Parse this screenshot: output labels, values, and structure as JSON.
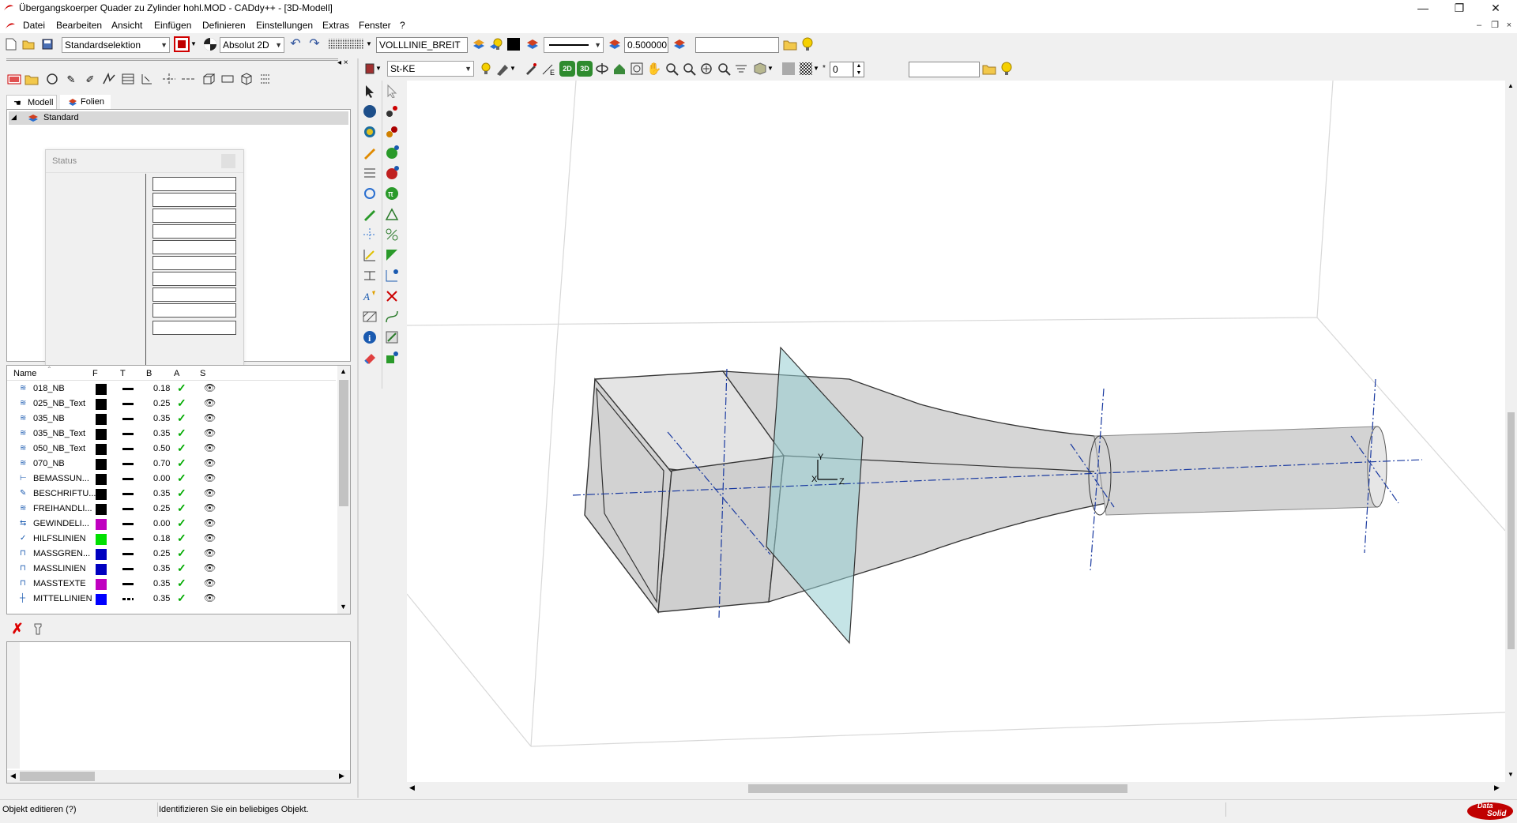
{
  "window": {
    "title": "Übergangskoerper Quader zu Zylinder hohl.MOD  -  CADdy++ - [3D-Modell]",
    "minimize_glyph": "—",
    "restore_glyph": "❐",
    "close_glyph": "✕"
  },
  "menu": [
    "Datei",
    "Bearbeiten",
    "Ansicht",
    "Einfügen",
    "Definieren",
    "Einstellungen",
    "Extras",
    "Fenster",
    "?"
  ],
  "toolbar1": {
    "selection_mode": "Standardselektion",
    "coordinate_mode": "Absolut 2D",
    "line_type_name": "VOLLLINIE_BREIT",
    "line_width": "0.500000",
    "search_value": ""
  },
  "toolbar2": {
    "material": "St-KE",
    "label_2d": "2D",
    "label_3d": "3D",
    "counter_value": "0",
    "search_value": ""
  },
  "panel": {
    "tab_model": "Modell",
    "tab_layers": "Folien",
    "tree_root": "Standard",
    "status_popup_title": "Status",
    "columns": [
      "Name",
      "F",
      "T",
      "B",
      "A",
      "S"
    ],
    "layers": [
      {
        "name": "018_NB",
        "color": "#000000",
        "width": "0.18",
        "icon": "layer-icon"
      },
      {
        "name": "025_NB_Text",
        "color": "#000000",
        "width": "0.25",
        "icon": "layer-icon"
      },
      {
        "name": "035_NB",
        "color": "#000000",
        "width": "0.35",
        "icon": "layer-icon"
      },
      {
        "name": "035_NB_Text",
        "color": "#000000",
        "width": "0.35",
        "icon": "layer-icon"
      },
      {
        "name": "050_NB_Text",
        "color": "#000000",
        "width": "0.50",
        "icon": "layer-icon"
      },
      {
        "name": "070_NB",
        "color": "#000000",
        "width": "0.70",
        "icon": "layer-icon"
      },
      {
        "name": "BEMASSUN...",
        "color": "#000000",
        "width": "0.00",
        "icon": "dimension-icon"
      },
      {
        "name": "BESCHRIFTU...",
        "color": "#000000",
        "width": "0.35",
        "icon": "text-edit-icon"
      },
      {
        "name": "FREIHANDLI...",
        "color": "#000000",
        "width": "0.25",
        "icon": "layer-icon"
      },
      {
        "name": "GEWINDELI...",
        "color": "#c000c0",
        "width": "0.00",
        "icon": "thread-icon"
      },
      {
        "name": "HILFSLINIEN",
        "color": "#00e000",
        "width": "0.18",
        "icon": "helpline-icon"
      },
      {
        "name": "MASSGREN...",
        "color": "#0000c0",
        "width": "0.25",
        "icon": "dim-limit-icon"
      },
      {
        "name": "MASSLINIEN",
        "color": "#0000c0",
        "width": "0.35",
        "icon": "dim-line-icon"
      },
      {
        "name": "MASSTEXTE",
        "color": "#c000c0",
        "width": "0.35",
        "icon": "dim-text-icon"
      },
      {
        "name": "MITTELLINIEN",
        "color": "#0000ff",
        "width": "0.35",
        "icon": "centerline-icon"
      }
    ]
  },
  "viewport": {
    "axis_y": "Y",
    "axis_x": "X",
    "axis_z": "Z"
  },
  "status": {
    "left": "Objekt editieren (?)",
    "message": "Identifizieren Sie ein beliebiges Objekt."
  },
  "brand": {
    "line1": "Data",
    "line2": "Solid"
  }
}
